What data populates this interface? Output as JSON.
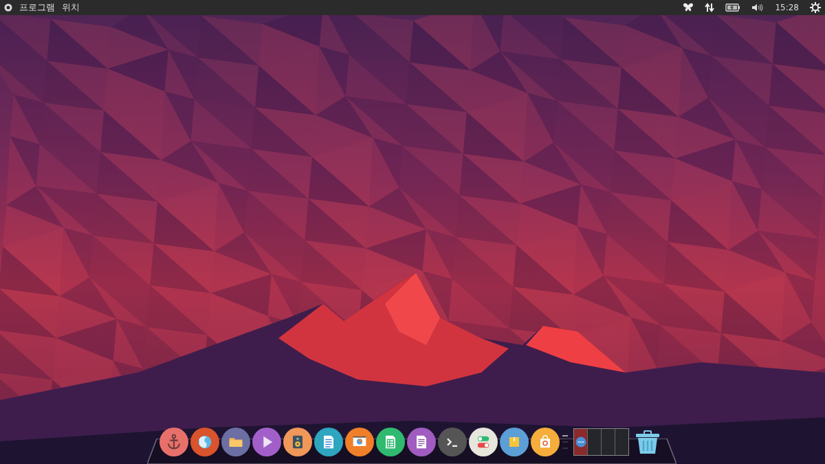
{
  "top_bar": {
    "menus": [
      {
        "label": "프로그램"
      },
      {
        "label": "위치"
      }
    ],
    "clock": "15:28"
  },
  "dock": {
    "items": [
      {
        "kind": "anchor",
        "color": "#e8706a"
      },
      {
        "kind": "browser",
        "color": "#d9532c"
      },
      {
        "kind": "folder",
        "color": "#6c6fa3"
      },
      {
        "kind": "play",
        "color": "#a35fc9"
      },
      {
        "kind": "speaker",
        "color": "#f0975a"
      },
      {
        "kind": "document",
        "color": "#2ea6bf"
      },
      {
        "kind": "presentation",
        "color": "#f07f2a"
      },
      {
        "kind": "spreadsheet",
        "color": "#2fba70"
      },
      {
        "kind": "text",
        "color": "#a05cc0"
      },
      {
        "kind": "terminal",
        "color": "#555555"
      },
      {
        "kind": "toggles",
        "color": "#e6e6dc"
      },
      {
        "kind": "package",
        "color": "#5b9fd6"
      },
      {
        "kind": "store",
        "color": "#f6ad3b"
      }
    ],
    "workspaces": [
      {
        "selected": true
      },
      {
        "selected": false
      },
      {
        "selected": false
      },
      {
        "selected": false
      }
    ]
  }
}
